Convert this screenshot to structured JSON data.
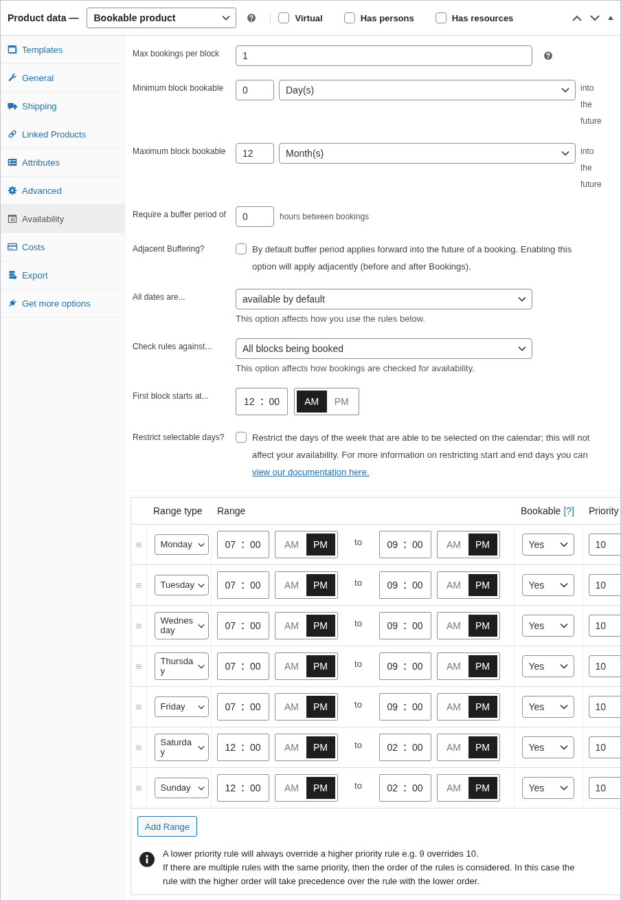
{
  "header": {
    "title": "Product data —",
    "product_type": "Bookable product",
    "options": [
      {
        "label": "Virtual",
        "checked": false
      },
      {
        "label": "Has persons",
        "checked": false
      },
      {
        "label": "Has resources",
        "checked": false
      }
    ]
  },
  "sidebar": {
    "items": [
      {
        "label": "Templates",
        "selected": false
      },
      {
        "label": "General",
        "selected": false
      },
      {
        "label": "Shipping",
        "selected": false
      },
      {
        "label": "Linked Products",
        "selected": false
      },
      {
        "label": "Attributes",
        "selected": false
      },
      {
        "label": "Advanced",
        "selected": false
      },
      {
        "label": "Availability",
        "selected": true
      },
      {
        "label": "Costs",
        "selected": false
      },
      {
        "label": "Export",
        "selected": false
      },
      {
        "label": "Get more options",
        "selected": false
      }
    ]
  },
  "settings": [
    {
      "kind": "input",
      "label": "Max bookings per block",
      "value": "1",
      "help": true
    },
    {
      "kind": "amount",
      "label": "Minimum block bookable",
      "value": "0",
      "unit": "Day(s)",
      "suffix": "into the future"
    },
    {
      "kind": "amount",
      "label": "Maximum block bookable",
      "value": "12",
      "unit": "Month(s)",
      "suffix": "into the future"
    },
    {
      "kind": "buffer",
      "label": "Require a buffer period of",
      "value": "0",
      "suffix": "hours between bookings"
    },
    {
      "kind": "checkbox",
      "label": "Adjacent Buffering?",
      "checked": false,
      "text": "By default buffer period applies forward into the future of a booking. Enabling this option will apply adjacently (before and after Bookings)."
    },
    {
      "kind": "select",
      "label": "All dates are...",
      "value": "available by default",
      "description": "This option affects how you use the rules below."
    },
    {
      "kind": "select",
      "label": "Check rules against...",
      "value": "All blocks being booked",
      "description": "This option affects how bookings are checked for availability."
    },
    {
      "kind": "time",
      "label": "First block starts at...",
      "hour": "12",
      "minute": "00",
      "period": [
        {
          "label": "AM",
          "selected": true
        },
        {
          "label": "PM",
          "selected": false
        }
      ]
    },
    {
      "kind": "checkbox",
      "label": "Restrict selectable days?",
      "checked": false,
      "text": "Restrict the days of the week that are able to be selected on the calendar; this will not affect your availability. For more information on restricting start and end days you can",
      "link": "view our documentation here."
    }
  ],
  "rules": {
    "columns": [
      {
        "label": "Range type"
      },
      {
        "label": "Range"
      },
      {
        "label": "Bookable",
        "help": "[?]"
      },
      {
        "label": "Priority"
      }
    ],
    "rows": [
      {
        "range_type": "Monday",
        "from": {
          "hour": "07",
          "minute": "00",
          "period": [
            {
              "label": "AM",
              "selected": false
            },
            {
              "label": "PM",
              "selected": true
            }
          ]
        },
        "separator": "to",
        "to": {
          "hour": "09",
          "minute": "00",
          "period": [
            {
              "label": "AM",
              "selected": false
            },
            {
              "label": "PM",
              "selected": true
            }
          ]
        },
        "bookable": "Yes",
        "priority": "10"
      },
      {
        "range_type": "Tuesday",
        "from": {
          "hour": "07",
          "minute": "00",
          "period": [
            {
              "label": "AM",
              "selected": false
            },
            {
              "label": "PM",
              "selected": true
            }
          ]
        },
        "separator": "to",
        "to": {
          "hour": "09",
          "minute": "00",
          "period": [
            {
              "label": "AM",
              "selected": false
            },
            {
              "label": "PM",
              "selected": true
            }
          ]
        },
        "bookable": "Yes",
        "priority": "10"
      },
      {
        "range_type": "Wednesday",
        "from": {
          "hour": "07",
          "minute": "00",
          "period": [
            {
              "label": "AM",
              "selected": false
            },
            {
              "label": "PM",
              "selected": true
            }
          ]
        },
        "separator": "to",
        "to": {
          "hour": "09",
          "minute": "00",
          "period": [
            {
              "label": "AM",
              "selected": false
            },
            {
              "label": "PM",
              "selected": true
            }
          ]
        },
        "bookable": "Yes",
        "priority": "10"
      },
      {
        "range_type": "Thursday",
        "from": {
          "hour": "07",
          "minute": "00",
          "period": [
            {
              "label": "AM",
              "selected": false
            },
            {
              "label": "PM",
              "selected": true
            }
          ]
        },
        "separator": "to",
        "to": {
          "hour": "09",
          "minute": "00",
          "period": [
            {
              "label": "AM",
              "selected": false
            },
            {
              "label": "PM",
              "selected": true
            }
          ]
        },
        "bookable": "Yes",
        "priority": "10"
      },
      {
        "range_type": "Friday",
        "from": {
          "hour": "07",
          "minute": "00",
          "period": [
            {
              "label": "AM",
              "selected": false
            },
            {
              "label": "PM",
              "selected": true
            }
          ]
        },
        "separator": "to",
        "to": {
          "hour": "09",
          "minute": "00",
          "period": [
            {
              "label": "AM",
              "selected": false
            },
            {
              "label": "PM",
              "selected": true
            }
          ]
        },
        "bookable": "Yes",
        "priority": "10"
      },
      {
        "range_type": "Saturday",
        "from": {
          "hour": "12",
          "minute": "00",
          "period": [
            {
              "label": "AM",
              "selected": false
            },
            {
              "label": "PM",
              "selected": true
            }
          ]
        },
        "separator": "to",
        "to": {
          "hour": "02",
          "minute": "00",
          "period": [
            {
              "label": "AM",
              "selected": false
            },
            {
              "label": "PM",
              "selected": true
            }
          ]
        },
        "bookable": "Yes",
        "priority": "10"
      },
      {
        "range_type": "Sunday",
        "from": {
          "hour": "12",
          "minute": "00",
          "period": [
            {
              "label": "AM",
              "selected": false
            },
            {
              "label": "PM",
              "selected": true
            }
          ]
        },
        "separator": "to",
        "to": {
          "hour": "02",
          "minute": "00",
          "period": [
            {
              "label": "AM",
              "selected": false
            },
            {
              "label": "PM",
              "selected": true
            }
          ]
        },
        "bookable": "Yes",
        "priority": "10"
      }
    ],
    "add_button": "Add Range",
    "notes": [
      "A lower priority rule will always override a higher priority rule e.g. 9 overrides 10.",
      "If there are multiple rules with the same priority, then the order of the rules is considered. In this case the rule with the higher order will take precedence over the rule with the lower order."
    ]
  }
}
